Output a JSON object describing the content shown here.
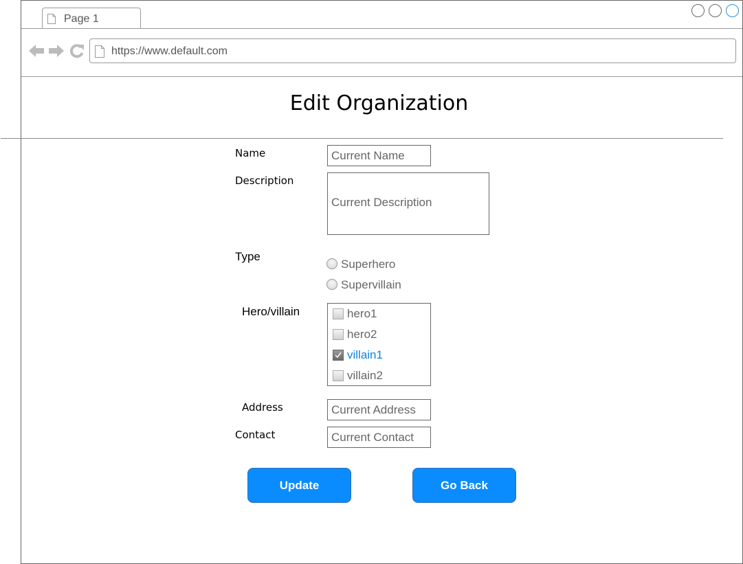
{
  "browser": {
    "tab_label": "Page 1",
    "url": "https://www.default.com"
  },
  "page": {
    "title": "Edit Organization"
  },
  "form": {
    "name": {
      "label": "Name",
      "placeholder": "Current Name"
    },
    "description": {
      "label": "Description",
      "placeholder": "Current Description"
    },
    "type": {
      "label": "Type",
      "options": [
        {
          "label": "Superhero",
          "selected": false
        },
        {
          "label": "Supervillain",
          "selected": false
        }
      ]
    },
    "hero_villain": {
      "label": "Hero/villain",
      "items": [
        {
          "label": "hero1",
          "checked": false
        },
        {
          "label": "hero2",
          "checked": false
        },
        {
          "label": "villain1",
          "checked": true
        },
        {
          "label": "villain2",
          "checked": false
        }
      ]
    },
    "address": {
      "label": "Address",
      "placeholder": "Current Address"
    },
    "contact": {
      "label": "Contact",
      "placeholder": "Current Contact"
    }
  },
  "actions": {
    "update_label": "Update",
    "go_back_label": "Go Back"
  },
  "colors": {
    "button_bg": "#0a8cff",
    "selected_text": "#0a84e0",
    "window_button_accent": "#2a93d5"
  },
  "icons": [
    "page-icon",
    "back-arrow-icon",
    "forward-arrow-icon",
    "reload-icon",
    "window-button-icon"
  ]
}
